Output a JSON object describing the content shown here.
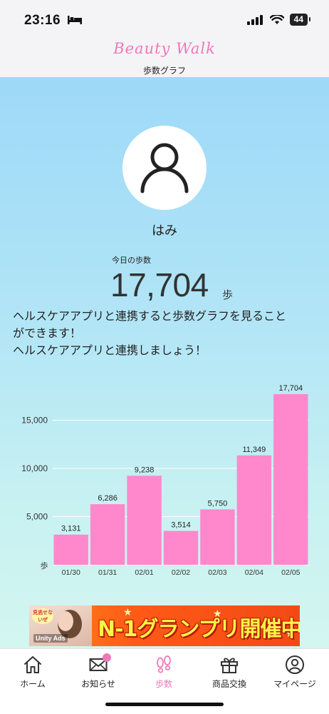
{
  "status_bar": {
    "time": "23:16",
    "battery": "44"
  },
  "header": {
    "brand": "Beauty Walk",
    "title": "歩数グラフ"
  },
  "profile": {
    "name": "はみ"
  },
  "today": {
    "label": "今日の歩数",
    "value": "17,704",
    "unit": "歩"
  },
  "message": {
    "line1": "ヘルスケアアプリと連携すると歩数グラフを見ること",
    "line2": "ができます！",
    "line3": "ヘルスケアアプリと連携しましょう！"
  },
  "chart_data": {
    "type": "bar",
    "categories": [
      "01/30",
      "01/31",
      "02/01",
      "02/02",
      "02/03",
      "02/04",
      "02/05"
    ],
    "values": [
      3131,
      6286,
      9238,
      3514,
      5750,
      11349,
      17704
    ],
    "value_labels": [
      "3,131",
      "6,286",
      "9,238",
      "3,514",
      "5,750",
      "11,349",
      "17,704"
    ],
    "yticks": [
      5000,
      10000,
      15000
    ],
    "ytick_labels": [
      "5,000",
      "10,000",
      "15,000"
    ],
    "ylabel": "歩",
    "ylim": [
      0,
      18000
    ],
    "bar_color": "#ff88cc",
    "grid": true
  },
  "ad": {
    "badge": "見逃せないぜ",
    "brand": "Unity Ads",
    "title": "N-1グランプリ開催中"
  },
  "tabs": [
    {
      "label": "ホーム",
      "icon": "home-icon"
    },
    {
      "label": "お知らせ",
      "icon": "mail-icon"
    },
    {
      "label": "歩数",
      "icon": "footprints-icon"
    },
    {
      "label": "商品交換",
      "icon": "gift-icon"
    },
    {
      "label": "マイページ",
      "icon": "user-icon"
    }
  ],
  "colors": {
    "accent": "#ef78b8",
    "bar": "#ff88cc",
    "background_top": "#9dd9f8",
    "background_bottom": "#d3f6f0"
  }
}
